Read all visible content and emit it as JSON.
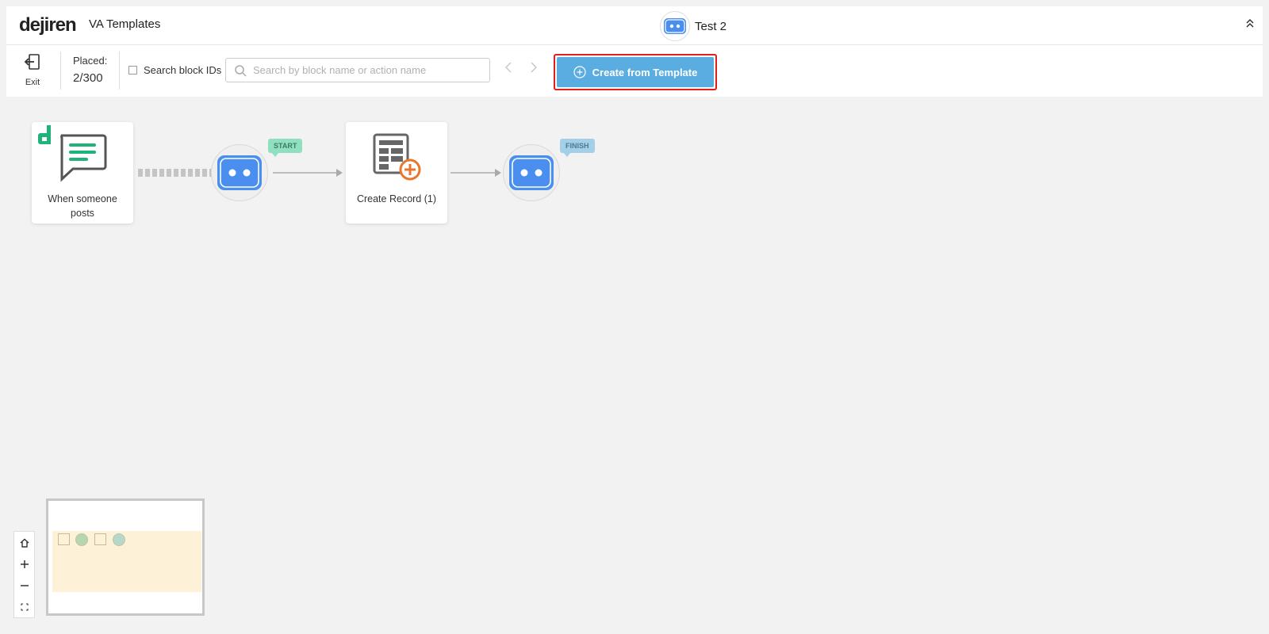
{
  "header": {
    "logo": "dejiren",
    "app_title": "VA Templates",
    "bot_name": "Test 2"
  },
  "toolbar": {
    "exit_label": "Exit",
    "placed_label": "Placed:",
    "placed_value": "2/300",
    "search_ids_label": "Search block IDs",
    "search_placeholder": "Search by block name or action name",
    "create_label": "Create from Template"
  },
  "flow": {
    "trigger_label": "When someone posts",
    "start_tag": "START",
    "action_label": "Create Record (1)",
    "finish_tag": "FINISH"
  },
  "colors": {
    "accent": "#5aade0",
    "highlight": "#e01e1e",
    "bot_blue": "#4a8fef",
    "chat_green": "#1fb37a",
    "add_orange": "#e8762b"
  },
  "icons": [
    "collapse-icon",
    "exit-icon",
    "search-icon",
    "plus-circle-icon",
    "chat-icon",
    "bot-icon",
    "table-add-icon",
    "home-icon",
    "zoom-in-icon",
    "zoom-out-icon",
    "fit-icon"
  ]
}
